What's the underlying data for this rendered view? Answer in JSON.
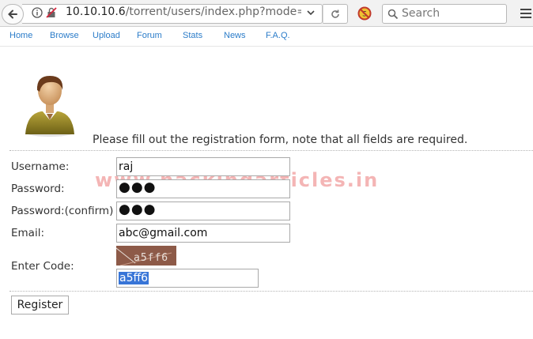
{
  "browser": {
    "url_host": "10.10.10.6",
    "url_path": "/torrent/users/index.php?mode=reg",
    "search_placeholder": "Search"
  },
  "nav": {
    "items": [
      "Home",
      "Browse",
      "Upload",
      "Forum",
      "Stats",
      "News",
      "F.A.Q."
    ]
  },
  "form": {
    "intro": "Please fill out the registration form, note that all fields are required.",
    "username_label": "Username:",
    "username_value": "raj",
    "password_label": "Password:",
    "password_value": "●●●",
    "confirm_label": "Password:(confirm)",
    "confirm_value": "●●●",
    "email_label": "Email:",
    "email_value": "abc@gmail.com",
    "code_label": "Enter Code:",
    "captcha_text": "a5ff6",
    "code_value": "a5ff6",
    "register_label": "Register"
  },
  "watermark": "www.hackingarticles.in",
  "colors": {
    "nav_link": "#2b7cc9",
    "captcha_bg": "#8d5a48",
    "selection": "#3875d7"
  }
}
